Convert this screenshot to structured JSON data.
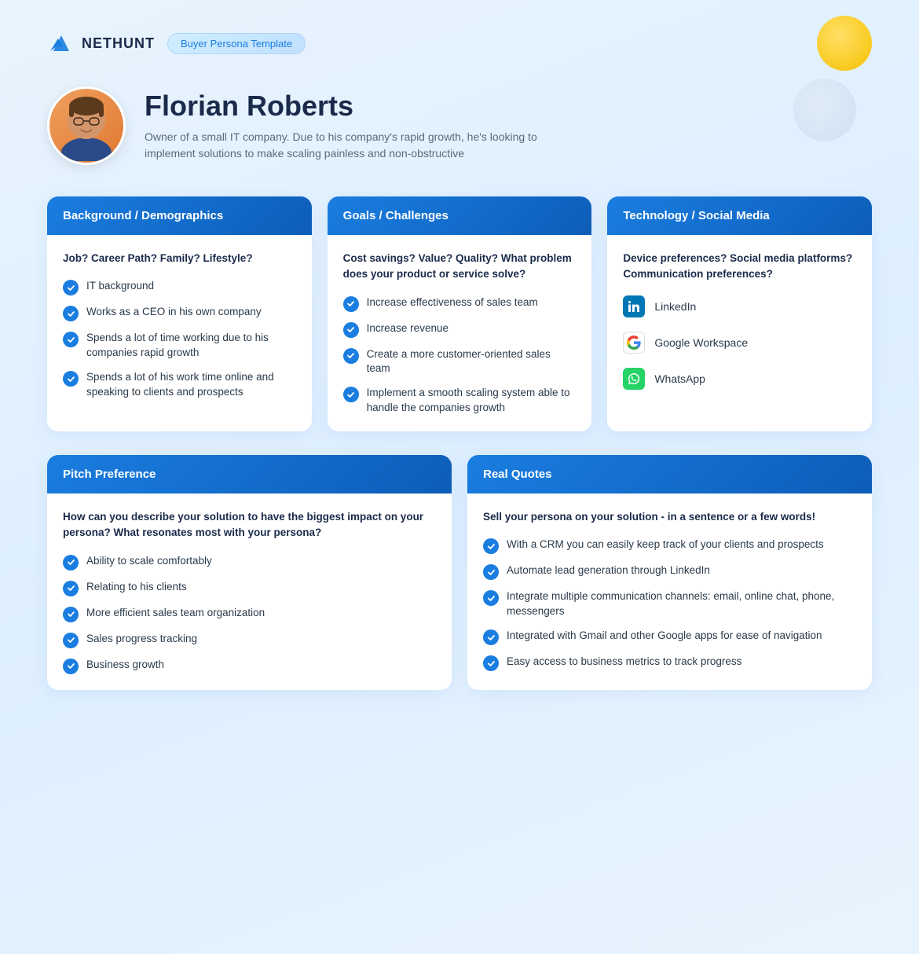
{
  "header": {
    "logo_text": "NetHunt",
    "badge_label": "Buyer Persona Template"
  },
  "hero": {
    "name": "Florian Roberts",
    "description": "Owner of a small IT company. Due to his company's rapid growth, he's looking to implement solutions to make scaling painless and non-obstructive",
    "avatar_emoji": "👨"
  },
  "sections": {
    "background": {
      "title": "Background / Demographics",
      "question": "Job? Career Path? Family? Lifestyle?",
      "items": [
        "IT background",
        "Works as a CEO in his own company",
        "Spends a lot of time working due to his companies rapid growth",
        "Spends a lot of his work time online and speaking to clients and prospects"
      ]
    },
    "goals": {
      "title": "Goals / Challenges",
      "question": "Cost savings? Value? Quality? What problem does your product or service solve?",
      "items": [
        "Increase effectiveness of sales team",
        "Increase revenue",
        "Create a more customer-oriented sales team",
        "Implement a smooth scaling system able to handle the companies growth"
      ]
    },
    "technology": {
      "title": "Technology / Social Media",
      "question": "Device preferences? Social media platforms? Communication preferences?",
      "social": [
        {
          "name": "LinkedIn",
          "type": "linkedin"
        },
        {
          "name": "Google Workspace",
          "type": "google"
        },
        {
          "name": "WhatsApp",
          "type": "whatsapp"
        }
      ]
    },
    "pitch": {
      "title": "Pitch Preference",
      "question": "How can you describe your solution to have the biggest impact on your persona? What resonates most with your persona?",
      "items": [
        "Ability to scale comfortably",
        "Relating to his clients",
        "More efficient sales team organization",
        "Sales progress tracking",
        "Business growth"
      ]
    },
    "quotes": {
      "title": "Real Quotes",
      "question": "Sell your persona on your solution - in a sentence or a few words!",
      "items": [
        "With a CRM you can easily keep track of your clients and prospects",
        "Automate lead generation through LinkedIn",
        "Integrate multiple communication channels: email, online chat, phone, messengers",
        "Integrated with Gmail and other Google apps for ease of navigation",
        "Easy access to business metrics to track progress"
      ]
    }
  }
}
